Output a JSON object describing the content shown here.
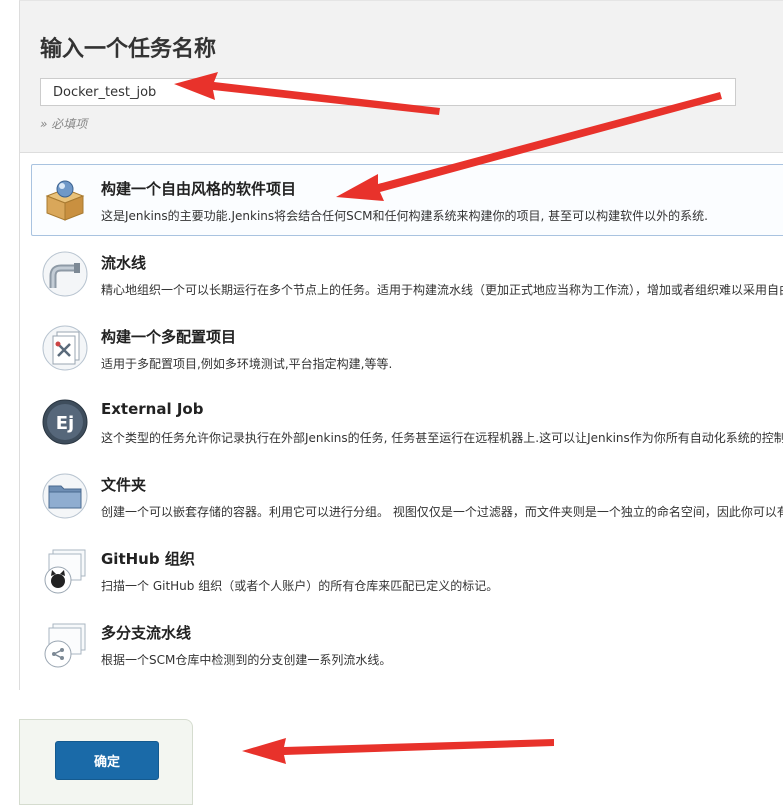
{
  "header": {
    "title": "输入一个任务名称",
    "job_name_value": "Docker_test_job",
    "required_hint": "» 必填项"
  },
  "items": [
    {
      "label": "构建一个自由风格的软件项目",
      "desc": "这是Jenkins的主要功能.Jenkins将会结合任何SCM和任何构建系统来构建你的项目, 甚至可以构建软件以外的系统.",
      "icon": "freestyle-box-icon",
      "selected": true
    },
    {
      "label": "流水线",
      "desc": "精心地组织一个可以长期运行在多个节点上的任务。适用于构建流水线（更加正式地应当称为工作流），增加或者组织难以采用自由风格的任务类型。",
      "icon": "pipeline-icon",
      "selected": false
    },
    {
      "label": "构建一个多配置项目",
      "desc": "适用于多配置项目,例如多环境测试,平台指定构建,等等.",
      "icon": "multi-config-icon",
      "selected": false
    },
    {
      "label": "External Job",
      "desc": "这个类型的任务允许你记录执行在外部Jenkins的任务, 任务甚至运行在远程机器上.这可以让Jenkins作为你所有自动化系统的控制面板.",
      "icon": "external-job-icon",
      "icon_text": "Ej",
      "selected": false
    },
    {
      "label": "文件夹",
      "desc": "创建一个可以嵌套存储的容器。利用它可以进行分组。 视图仅仅是一个过滤器，而文件夹则是一个独立的命名空间，因此你可以有多个相同名称的的内容，只要它们在不同的文件夹里即可。",
      "icon": "folder-icon",
      "selected": false
    },
    {
      "label": "GitHub 组织",
      "desc": "扫描一个 GitHub 组织（或者个人账户）的所有仓库来匹配已定义的标记。",
      "icon": "github-org-icon",
      "selected": false
    },
    {
      "label": "多分支流水线",
      "desc": "根据一个SCM仓库中检测到的分支创建一系列流水线。",
      "icon": "multibranch-icon",
      "selected": false
    }
  ],
  "footer": {
    "ok_label": "确定"
  },
  "colors": {
    "ok_button": "#1a6aa8",
    "annotation_arrow": "#e8322b",
    "selected_border": "#a9c3e0"
  }
}
